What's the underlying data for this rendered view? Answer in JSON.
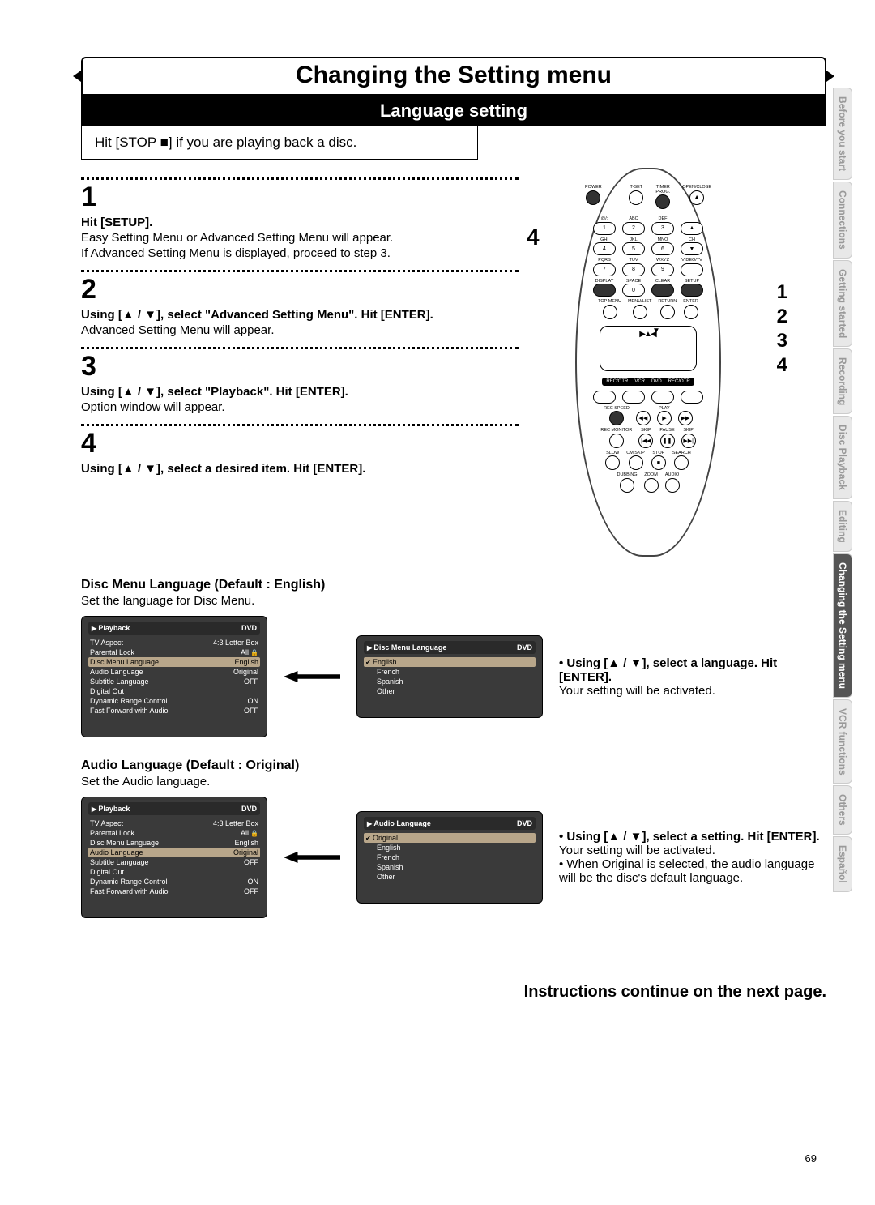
{
  "title": "Changing the Setting menu",
  "subtitle": "Language setting",
  "hit_stop": "Hit [STOP ■] if you are playing back a disc.",
  "steps": {
    "s1": {
      "num": "1",
      "title": "Hit [SETUP].",
      "body1": "Easy Setting Menu or Advanced Setting Menu will appear.",
      "body2": "If Advanced Setting Menu is displayed, proceed to step 3."
    },
    "s2": {
      "num": "2",
      "title": "Using [▲ / ▼], select \"Advanced Setting Menu\". Hit [ENTER].",
      "body": "Advanced Setting Menu will appear."
    },
    "s3": {
      "num": "3",
      "title": "Using [▲ / ▼], select \"Playback\". Hit [ENTER].",
      "body": "Option window will appear."
    },
    "s4": {
      "num": "4",
      "title": "Using [▲ / ▼], select a desired item. Hit [ENTER]."
    }
  },
  "remote_callouts": {
    "big4": "4",
    "n1": "1",
    "n2": "2",
    "n3": "3",
    "n4": "4"
  },
  "remote_labels": {
    "row0": [
      "POWER",
      "",
      "T-SET",
      "TIMER PROG.",
      "OPEN/CLOSE"
    ],
    "row1": [
      "@/:",
      "ABC",
      "DEF",
      ""
    ],
    "row1b": [
      "1",
      "2",
      "3",
      "▲"
    ],
    "row1c": [
      "GHI",
      "JKL",
      "MNO",
      "CH"
    ],
    "row2": [
      "4",
      "5",
      "6",
      "▼"
    ],
    "row2c": [
      "PQRS",
      "TUV",
      "WXYZ",
      "VIDEO/TV"
    ],
    "row3": [
      "7",
      "8",
      "9",
      ""
    ],
    "row3c": [
      "DISPLAY",
      "SPACE",
      "CLEAR",
      "SETUP"
    ],
    "row4": [
      "",
      "0",
      "",
      ""
    ],
    "row4c": [
      "TOP MENU",
      "MENU/LIST",
      "RETURN",
      "ENTER"
    ],
    "mode": [
      "REC/OTR",
      "VCR",
      "DVD",
      "REC/OTR"
    ],
    "speed": [
      "REC SPEED",
      "",
      "PLAY",
      ""
    ],
    "trans": [
      "REC MONITOR",
      "SKIP",
      "PAUSE",
      "SKIP"
    ],
    "trans2": [
      "SLOW",
      "CM SKIP",
      "STOP",
      "SEARCH"
    ],
    "bottom": [
      "DUBBING",
      "ZOOM",
      "AUDIO"
    ]
  },
  "disc_menu": {
    "heading": "Disc Menu Language (Default : English)",
    "sub": "Set the language for Disc Menu.",
    "screen1_title": "Playback",
    "screen_tag": "DVD",
    "rows1": [
      {
        "l": "TV Aspect",
        "r": "4:3 Letter Box"
      },
      {
        "l": "Parental Lock",
        "r": "All"
      },
      {
        "l": "Disc Menu Language",
        "r": "English",
        "sel": true
      },
      {
        "l": "Audio Language",
        "r": "Original"
      },
      {
        "l": "Subtitle Language",
        "r": "OFF"
      },
      {
        "l": "Digital Out",
        "r": ""
      },
      {
        "l": "Dynamic Range Control",
        "r": "ON"
      },
      {
        "l": "Fast Forward with Audio",
        "r": "OFF"
      }
    ],
    "screen2_title": "Disc Menu Language",
    "rows2": [
      "English",
      "French",
      "Spanish",
      "Other"
    ],
    "note_title": "• Using [▲ / ▼], select a language. Hit [ENTER].",
    "note_body": "Your setting will be activated."
  },
  "audio_lang": {
    "heading": "Audio Language (Default : Original)",
    "sub": "Set the Audio language.",
    "screen1_title": "Playback",
    "screen_tag": "DVD",
    "rows1": [
      {
        "l": "TV Aspect",
        "r": "4:3 Letter Box"
      },
      {
        "l": "Parental Lock",
        "r": "All"
      },
      {
        "l": "Disc Menu Language",
        "r": "English"
      },
      {
        "l": "Audio Language",
        "r": "Original",
        "sel": true
      },
      {
        "l": "Subtitle Language",
        "r": "OFF"
      },
      {
        "l": "Digital Out",
        "r": ""
      },
      {
        "l": "Dynamic Range Control",
        "r": "ON"
      },
      {
        "l": "Fast Forward with Audio",
        "r": "OFF"
      }
    ],
    "screen2_title": "Audio Language",
    "rows2": [
      "Original",
      "English",
      "French",
      "Spanish",
      "Other"
    ],
    "note_title": "• Using [▲ / ▼], select a setting. Hit [ENTER].",
    "note_body": "Your setting will be activated.",
    "note_extra": "• When Original is selected, the audio language will be the disc's default language."
  },
  "continue": "Instructions continue on the next page.",
  "page": "69",
  "tabs": [
    "Before you start",
    "Connections",
    "Getting started",
    "Recording",
    "Disc Playback",
    "Editing",
    "Changing the Setting menu",
    "VCR functions",
    "Others",
    "Español"
  ]
}
